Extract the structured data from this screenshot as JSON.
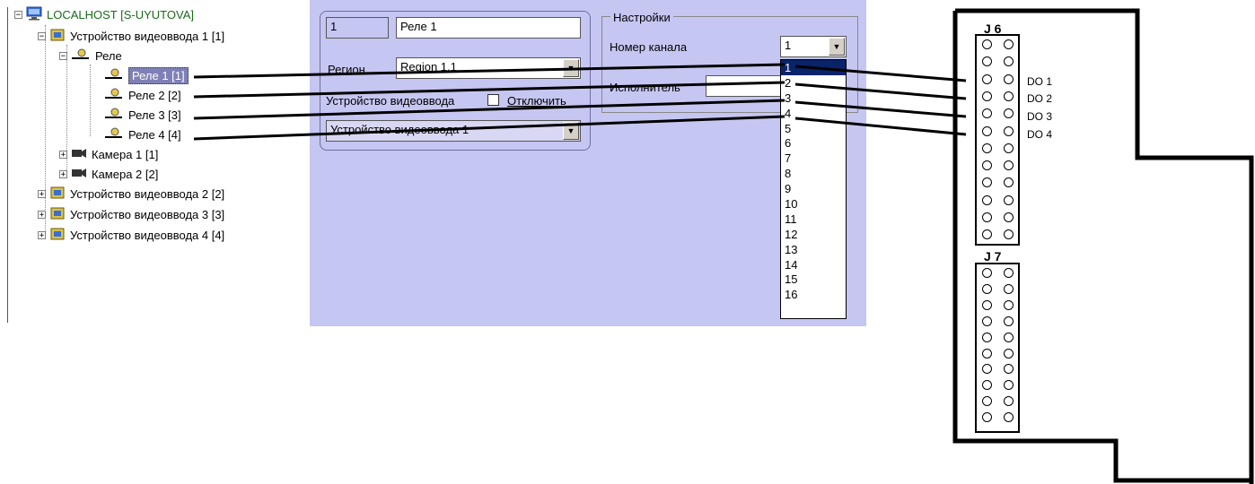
{
  "tree": {
    "root": "LOCALHOST [S-UYUTOVA]",
    "device1": "Устройство видеоввода 1 [1]",
    "relay_group": "Реле",
    "relays": [
      "Реле 1 [1]",
      "Реле 2 [2]",
      "Реле 3 [3]",
      "Реле 4 [4]"
    ],
    "cameras": [
      "Камера 1 [1]",
      "Камера 2 [2]"
    ],
    "devices_more": [
      "Устройство видеоввода 2 [2]",
      "Устройство видеоввода 3 [3]",
      "Устройство видеоввода 4 [4]"
    ]
  },
  "form": {
    "id_value": "1",
    "name_value": "Реле 1",
    "region_label": "Регион",
    "region_value": "Region 1.1",
    "device_label": "Устройство видеоввода",
    "disable_label": "Отключить",
    "device_value": "Устройство видеоввода 1",
    "settings_title": "Настройки",
    "channel_label": "Номер канала",
    "channel_value": "1",
    "executor_label": "Исполнитель",
    "channel_options": [
      "1",
      "2",
      "3",
      "4",
      "5",
      "6",
      "7",
      "8",
      "9",
      "10",
      "11",
      "12",
      "13",
      "14",
      "15",
      "16"
    ]
  },
  "board": {
    "j6": "J 6",
    "j7": "J 7",
    "outputs": [
      "DO 1",
      "DO 2",
      "DO 3",
      "DO 4"
    ]
  },
  "colors": {
    "panel_bg": "#c6c6f2",
    "selection_bg": "#7f80b6",
    "dropdown_highlight": "#0a246a",
    "root_text": "#1a6a1a"
  },
  "icons": {
    "computer": "monitor-icon",
    "device": "chip-icon",
    "relay": "relay-icon",
    "camera": "camera-icon"
  }
}
